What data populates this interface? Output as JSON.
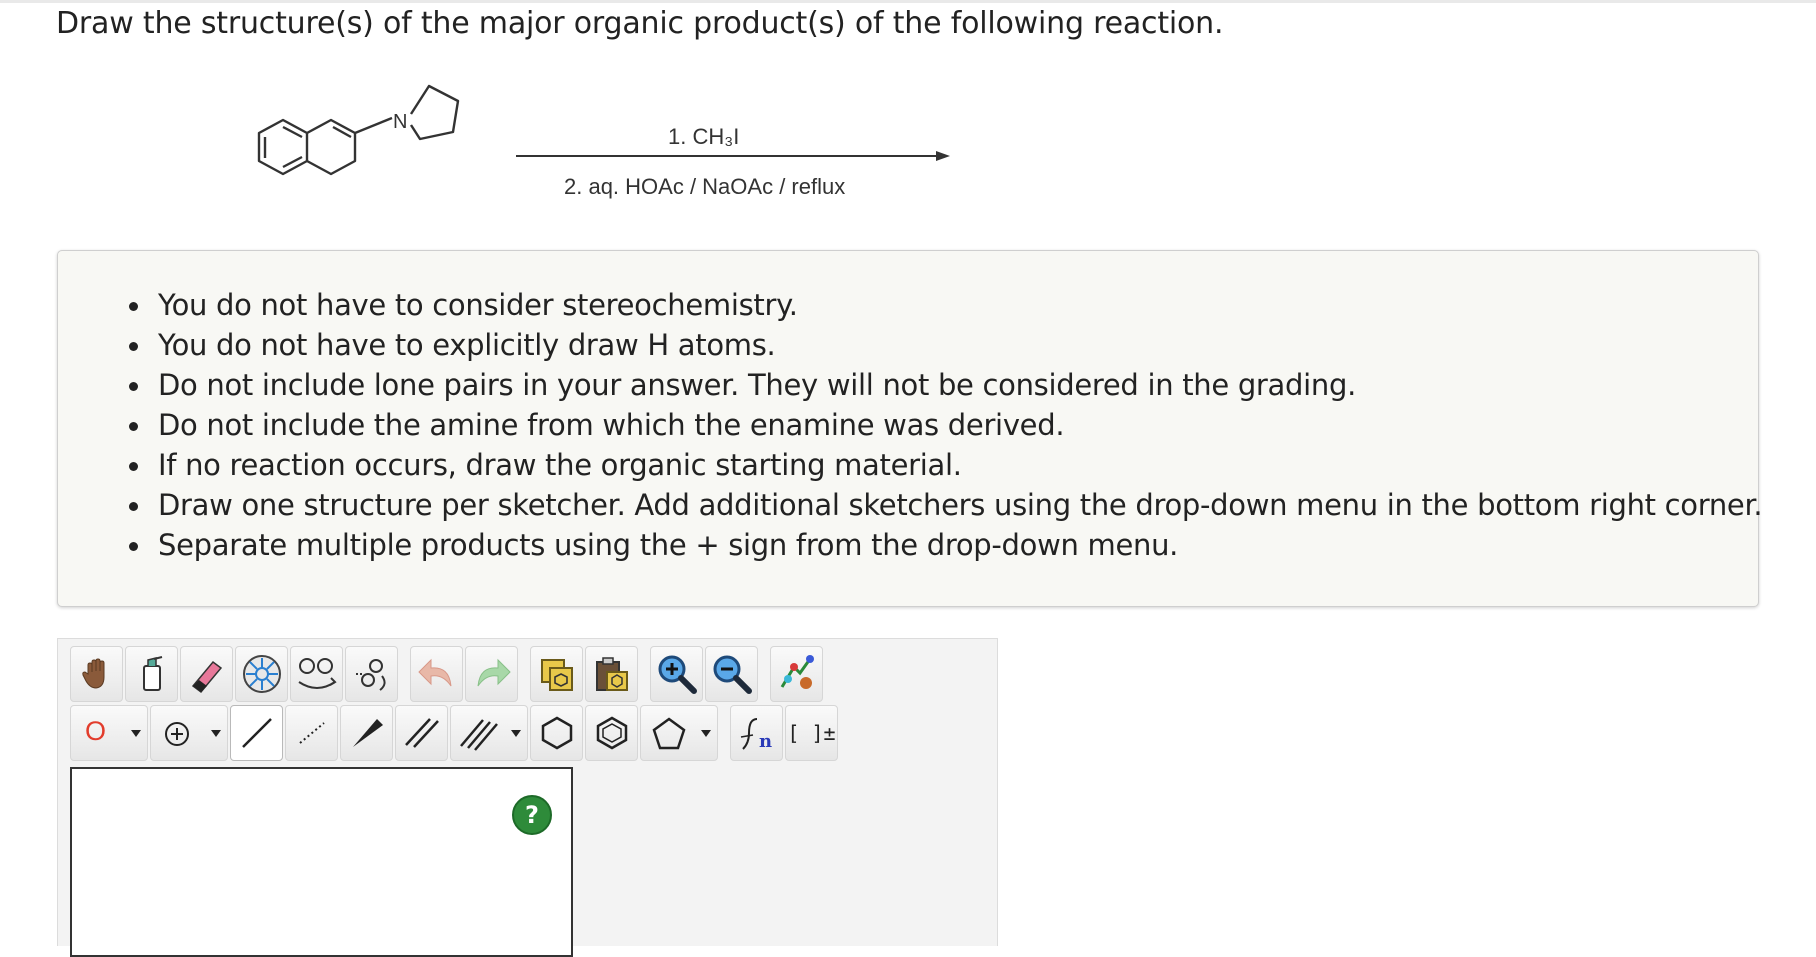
{
  "question": {
    "prompt": "Draw the structure(s) of the major organic product(s) of the following reaction."
  },
  "reaction": {
    "starting_material_atom_label": "N",
    "reagent_step1": "1. CH₃I",
    "reagent_step2": "2. aq. HOAc / NaOAc / reflux"
  },
  "instructions": {
    "items": [
      "You do not have to consider stereochemistry.",
      "You do not have to explicitly draw H atoms.",
      "Do not include lone pairs in your answer. They will not be considered in the grading.",
      "Do not include the amine from which the enamine was derived.",
      "If no reaction occurs, draw the organic starting material.",
      "Draw one structure per sketcher. Add additional sketchers using the drop-down menu in the bottom right corner.",
      "Separate multiple products using the + sign from the drop-down menu."
    ]
  },
  "sketcher": {
    "toolbar_row1": [
      "hand-icon",
      "erase-all-icon",
      "eraser-icon",
      "ring-template-icon",
      "clean-structure-icon",
      "cleanup-2d-icon",
      "undo-icon",
      "redo-icon",
      "copy-icon",
      "paste-icon",
      "zoom-in-icon",
      "zoom-out-icon",
      "explicit-h-icon"
    ],
    "toolbar_row2": [
      "element-O",
      "charge-icon",
      "single-bond-icon",
      "hashed-bond-icon",
      "wedge-bond-icon",
      "double-bond-icon",
      "triple-bond-icon",
      "cyclohexane-icon",
      "benzene-icon",
      "cyclopentane-icon",
      "sgroup-icon",
      "bracket-icon"
    ],
    "element_label": "O",
    "sgroup_label": "n",
    "bracket_label": "[ ]±",
    "help_label": "?"
  },
  "colors": {
    "help_button": "#2e8b3a",
    "element_oxygen": "#e23c2c",
    "instruction_bg": "#f8f8f4",
    "sketcher_bg": "#f3f3f3"
  }
}
